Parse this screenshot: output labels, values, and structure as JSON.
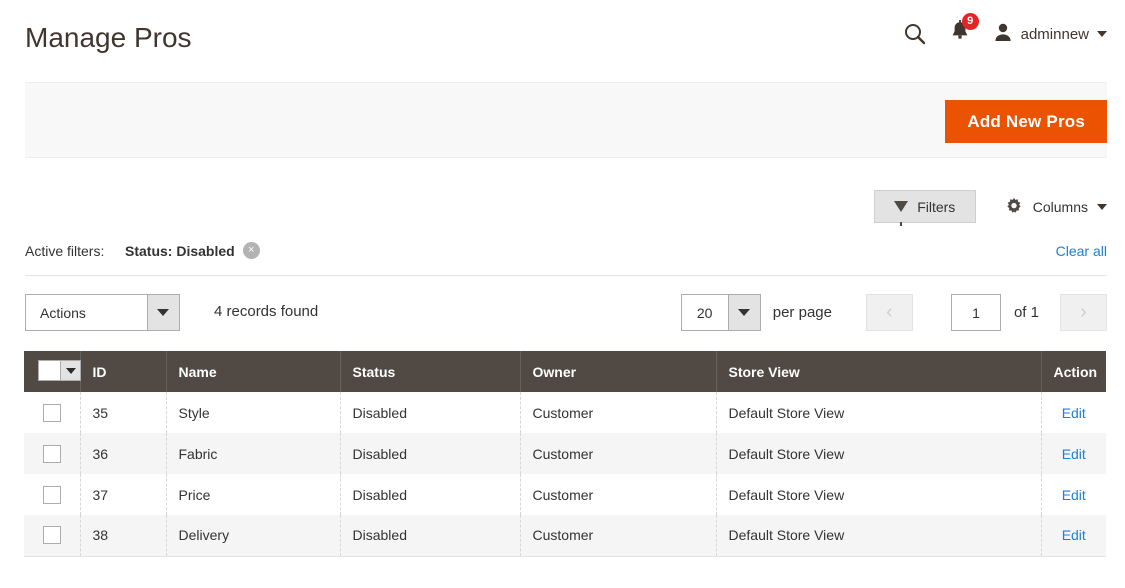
{
  "header": {
    "title": "Manage Pros",
    "search_icon": "search-icon",
    "notifications": {
      "icon": "bell-icon",
      "count": "9"
    },
    "user": {
      "avatar_icon": "user-avatar-icon",
      "name": "adminnew",
      "caret": "chevron-down-icon"
    }
  },
  "action_band": {
    "add_button": "Add New Pros"
  },
  "grid_controls": {
    "filters_label": "Filters",
    "filters_icon": "funnel-icon",
    "columns_label": "Columns",
    "columns_icon": "gear-icon",
    "columns_caret": "chevron-down-icon"
  },
  "active_filters": {
    "label": "Active filters:",
    "chips": [
      {
        "text": "Status: Disabled",
        "remove_icon": "×"
      }
    ],
    "clear_all": "Clear all"
  },
  "toolbar": {
    "actions_label": "Actions",
    "records_found": "4 records found",
    "per_page_value": "20",
    "per_page_label": "per page",
    "prev_icon": "‹",
    "next_icon": "›",
    "page_value": "1",
    "of_label": "of 1"
  },
  "grid": {
    "columns": [
      "",
      "ID",
      "Name",
      "Status",
      "Owner",
      "Store View",
      "Action"
    ],
    "rows": [
      {
        "id": "35",
        "name": "Style",
        "status": "Disabled",
        "owner": "Customer",
        "store_view": "Default Store View",
        "action": "Edit"
      },
      {
        "id": "36",
        "name": "Fabric",
        "status": "Disabled",
        "owner": "Customer",
        "store_view": "Default Store View",
        "action": "Edit"
      },
      {
        "id": "37",
        "name": "Price",
        "status": "Disabled",
        "owner": "Customer",
        "store_view": "Default Store View",
        "action": "Edit"
      },
      {
        "id": "38",
        "name": "Delivery",
        "status": "Disabled",
        "owner": "Customer",
        "store_view": "Default Store View",
        "action": "Edit"
      }
    ]
  },
  "colors": {
    "primary_button": "#eb5202",
    "header_row": "#514943",
    "link": "#1f7fd6",
    "badge": "#e22626"
  }
}
